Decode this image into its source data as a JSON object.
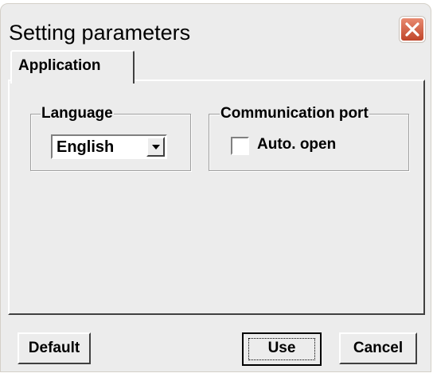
{
  "window": {
    "title": "Setting parameters",
    "close_icon": "close-icon"
  },
  "tabs": [
    {
      "label": "Application",
      "selected": true
    }
  ],
  "language_group": {
    "legend": "Language",
    "select_value": "English",
    "dropdown_icon": "chevron-down-icon"
  },
  "comm_group": {
    "legend": "Communication port",
    "checkbox_label": "Auto. open",
    "checkbox_checked": false
  },
  "buttons": {
    "default_label": "Default",
    "use_label": "Use",
    "cancel_label": "Cancel"
  },
  "colors": {
    "close_button": "#d9593c",
    "dialog_bg": "#ececec"
  }
}
